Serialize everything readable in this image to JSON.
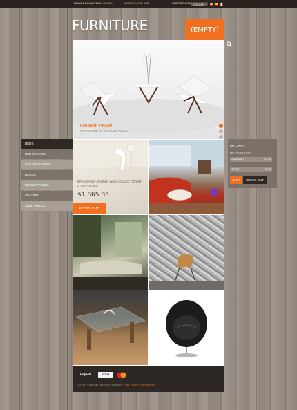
{
  "topbar": {
    "account": "YOUR ACCOUNT",
    "welcome": "WELCOME,",
    "user": "ADAM",
    "close": "CLOSE OUT",
    "currency_label": "CURRENCIES",
    "currency_value": "Dollar"
  },
  "header": {
    "logo": "FURNITURE",
    "cart_label": "(EMPTY)"
  },
  "slider": {
    "title": "LOUNGE CHAIR",
    "subtitle": "FURNITURE BY MICHAEL WOLK ›",
    "dots": 3,
    "active_dot": 1
  },
  "categories": [
    "BEDS",
    "BAR SEATING",
    "COFFEE TABLES",
    "DESKS",
    "DINING TABLES",
    "SEATING",
    "SIDE TABLES"
  ],
  "promo": {
    "text": "BRAND NEW MARBLE WALL COLLECTION BY G GO PROJECT",
    "price": "$1,865.85",
    "button": "ADD TO CART"
  },
  "mycart": {
    "title": "MY CART",
    "empty": "NO PRODUCTS",
    "shipping_label": "SHIPPING",
    "shipping_value": "$0.00",
    "total_label": "TOTAL",
    "total_value": "$0.00",
    "cart_button": "CART",
    "checkout_button": "CHECK OUT"
  },
  "footer": {
    "paypal": "PayPal",
    "visa": "VISA",
    "copyright": "© 2013 POWERED BY PRESTASHOP™",
    "rights": "ALL RIGHTS RESERVED"
  },
  "colors": {
    "accent": "#f26f1f",
    "dark": "#2e2824",
    "panel": "#7b7168"
  }
}
